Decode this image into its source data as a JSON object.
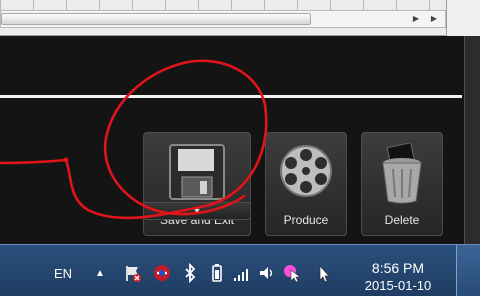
{
  "toolbar": {
    "save_label": "Save and Exit",
    "produce_label": "Produce",
    "delete_label": "Delete",
    "dropdown_symbol": "▼"
  },
  "taskbar": {
    "language": "EN",
    "tray_expand": "▲",
    "time": "8:56 PM",
    "date": "2015-01-10"
  },
  "icons": {
    "save": "floppy-disk-icon",
    "produce": "film-reel-icon",
    "delete": "trash-bin-icon"
  },
  "colors": {
    "annotation": "#e0141a",
    "taskbar": "#234670",
    "panel": "#141414"
  }
}
